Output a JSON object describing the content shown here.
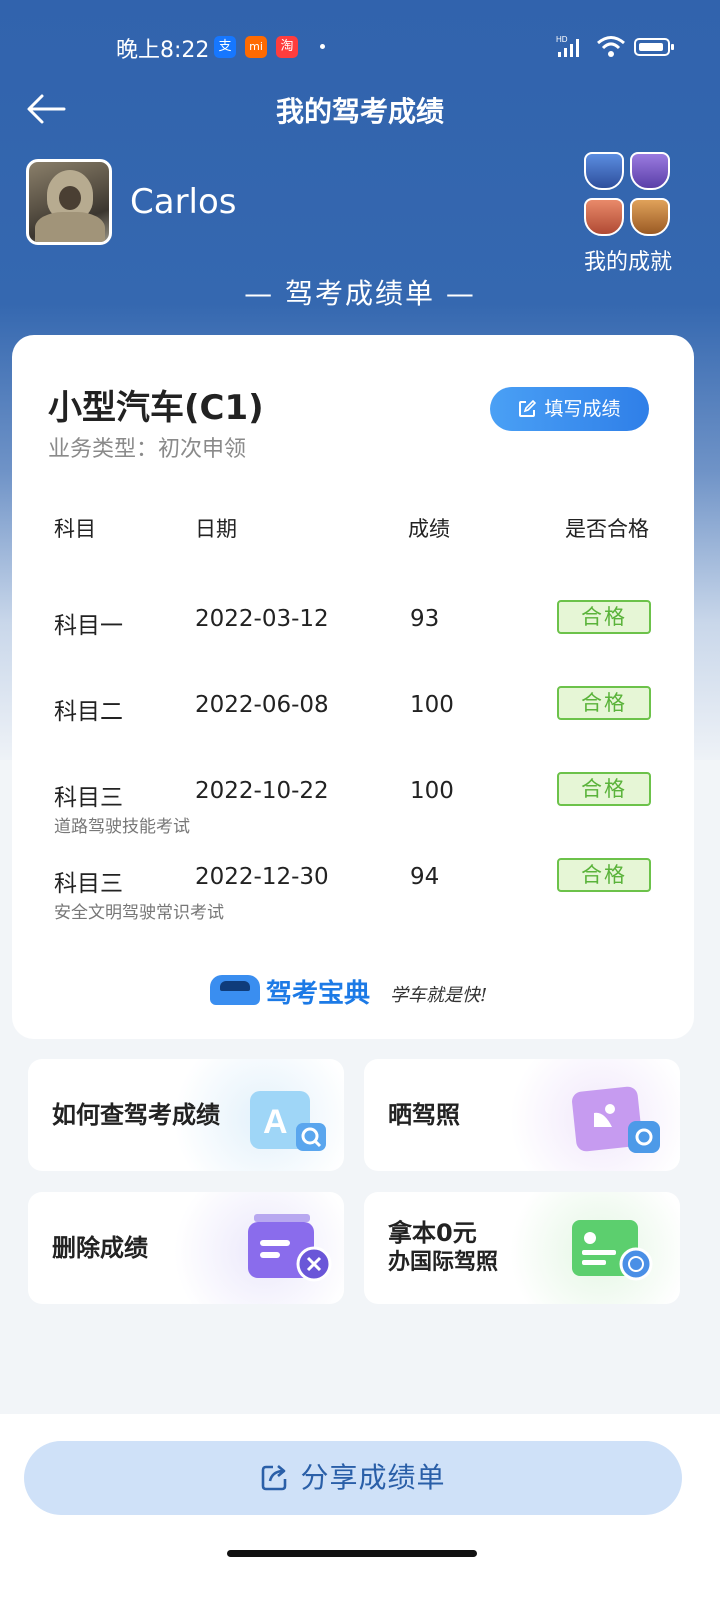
{
  "status_bar": {
    "time": "晚上8:22",
    "notif_icons": [
      {
        "name": "alipay-icon",
        "glyph": "支",
        "color": "#1677ff"
      },
      {
        "name": "mi-icon",
        "glyph": "mi",
        "color": "#ff6a00"
      },
      {
        "name": "taobao-icon",
        "glyph": "淘",
        "color": "#ff3d3d"
      }
    ],
    "network": "HD"
  },
  "header": {
    "title": "我的驾考成绩"
  },
  "profile": {
    "name": "Carlos",
    "achievements_label": "我的成就"
  },
  "sheet_title": "— 驾考成绩单 —",
  "card": {
    "vehicle": "小型汽车(C1)",
    "business_type": "业务类型：初次申领",
    "fill_button": "填写成绩",
    "columns": [
      "科目",
      "日期",
      "成绩",
      "是否合格"
    ],
    "rows": [
      {
        "subject": "科目一",
        "note": "",
        "date": "2022-03-12",
        "score": "93",
        "result": "合格"
      },
      {
        "subject": "科目二",
        "note": "",
        "date": "2022-06-08",
        "score": "100",
        "result": "合格"
      },
      {
        "subject": "科目三",
        "note": "道路驾驶技能考试",
        "date": "2022-10-22",
        "score": "100",
        "result": "合格"
      },
      {
        "subject": "科目三",
        "note": "安全文明驾驶常识考试",
        "date": "2022-12-30",
        "score": "94",
        "result": "合格"
      }
    ],
    "brand": {
      "name": "驾考宝典",
      "slogan": "学车就是快!"
    }
  },
  "tiles": [
    {
      "label": "如何查驾考成绩",
      "icon": "search-doc-icon"
    },
    {
      "label": "晒驾照",
      "icon": "photo-share-icon"
    },
    {
      "label": "删除成绩",
      "icon": "delete-record-icon"
    },
    {
      "label_line1": "拿本0元",
      "label_line2": "办国际驾照",
      "icon": "intl-license-icon"
    }
  ],
  "share_button": "分享成绩单",
  "colors": {
    "primary": "#3163ad",
    "pass_green": "#5ab33a",
    "button_blue": "#2f7fe8"
  }
}
